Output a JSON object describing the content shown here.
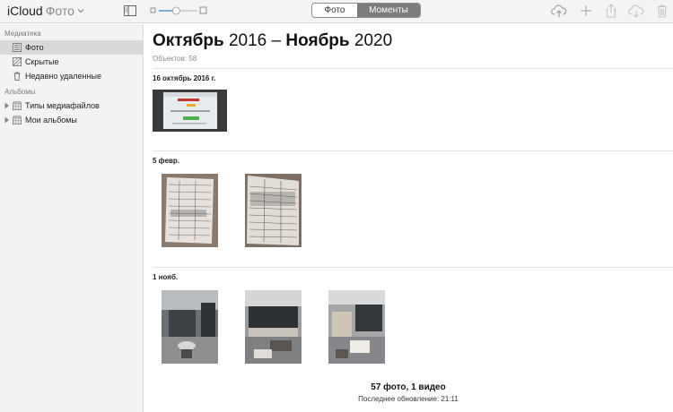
{
  "toolbar": {
    "brand_icloud": "iCloud",
    "brand_app": "Фото",
    "segments": {
      "photo": "Фото",
      "moments": "Моменты"
    },
    "selected_segment": "moments",
    "zoom_level": 0.45
  },
  "sidebar": {
    "library_label": "Медиатека",
    "library_items": [
      {
        "label": "Фото",
        "icon": "photos-icon",
        "selected": true
      },
      {
        "label": "Скрытые",
        "icon": "hidden-icon",
        "selected": false
      },
      {
        "label": "Недавно удаленные",
        "icon": "trash-icon",
        "selected": false
      }
    ],
    "albums_label": "Альбомы",
    "album_items": [
      {
        "label": "Типы медиафайлов",
        "icon": "album-icon"
      },
      {
        "label": "Мои альбомы",
        "icon": "album-icon"
      }
    ]
  },
  "main": {
    "title_month_start": "Октябрь",
    "title_year_start": "2016",
    "title_dash": "–",
    "title_month_end": "Ноябрь",
    "title_year_end": "2020",
    "subtitle": "Объектов: 58",
    "moments": [
      {
        "date": "16 октябрь 2016 г.",
        "photo_count": 1
      },
      {
        "date": "5 февр.",
        "photo_count": 2
      },
      {
        "date": "1 нояб.",
        "photo_count": 3
      }
    ],
    "footer_count": "57 фото, 1 видео",
    "footer_update": "Последнее обновление: 21:11"
  },
  "colors": {
    "toolbar_bg": "#f4f4f4",
    "sidebar_bg": "#f3f3f3",
    "selected_row": "#d9d9d9",
    "segment_active": "#7c7c7c"
  }
}
